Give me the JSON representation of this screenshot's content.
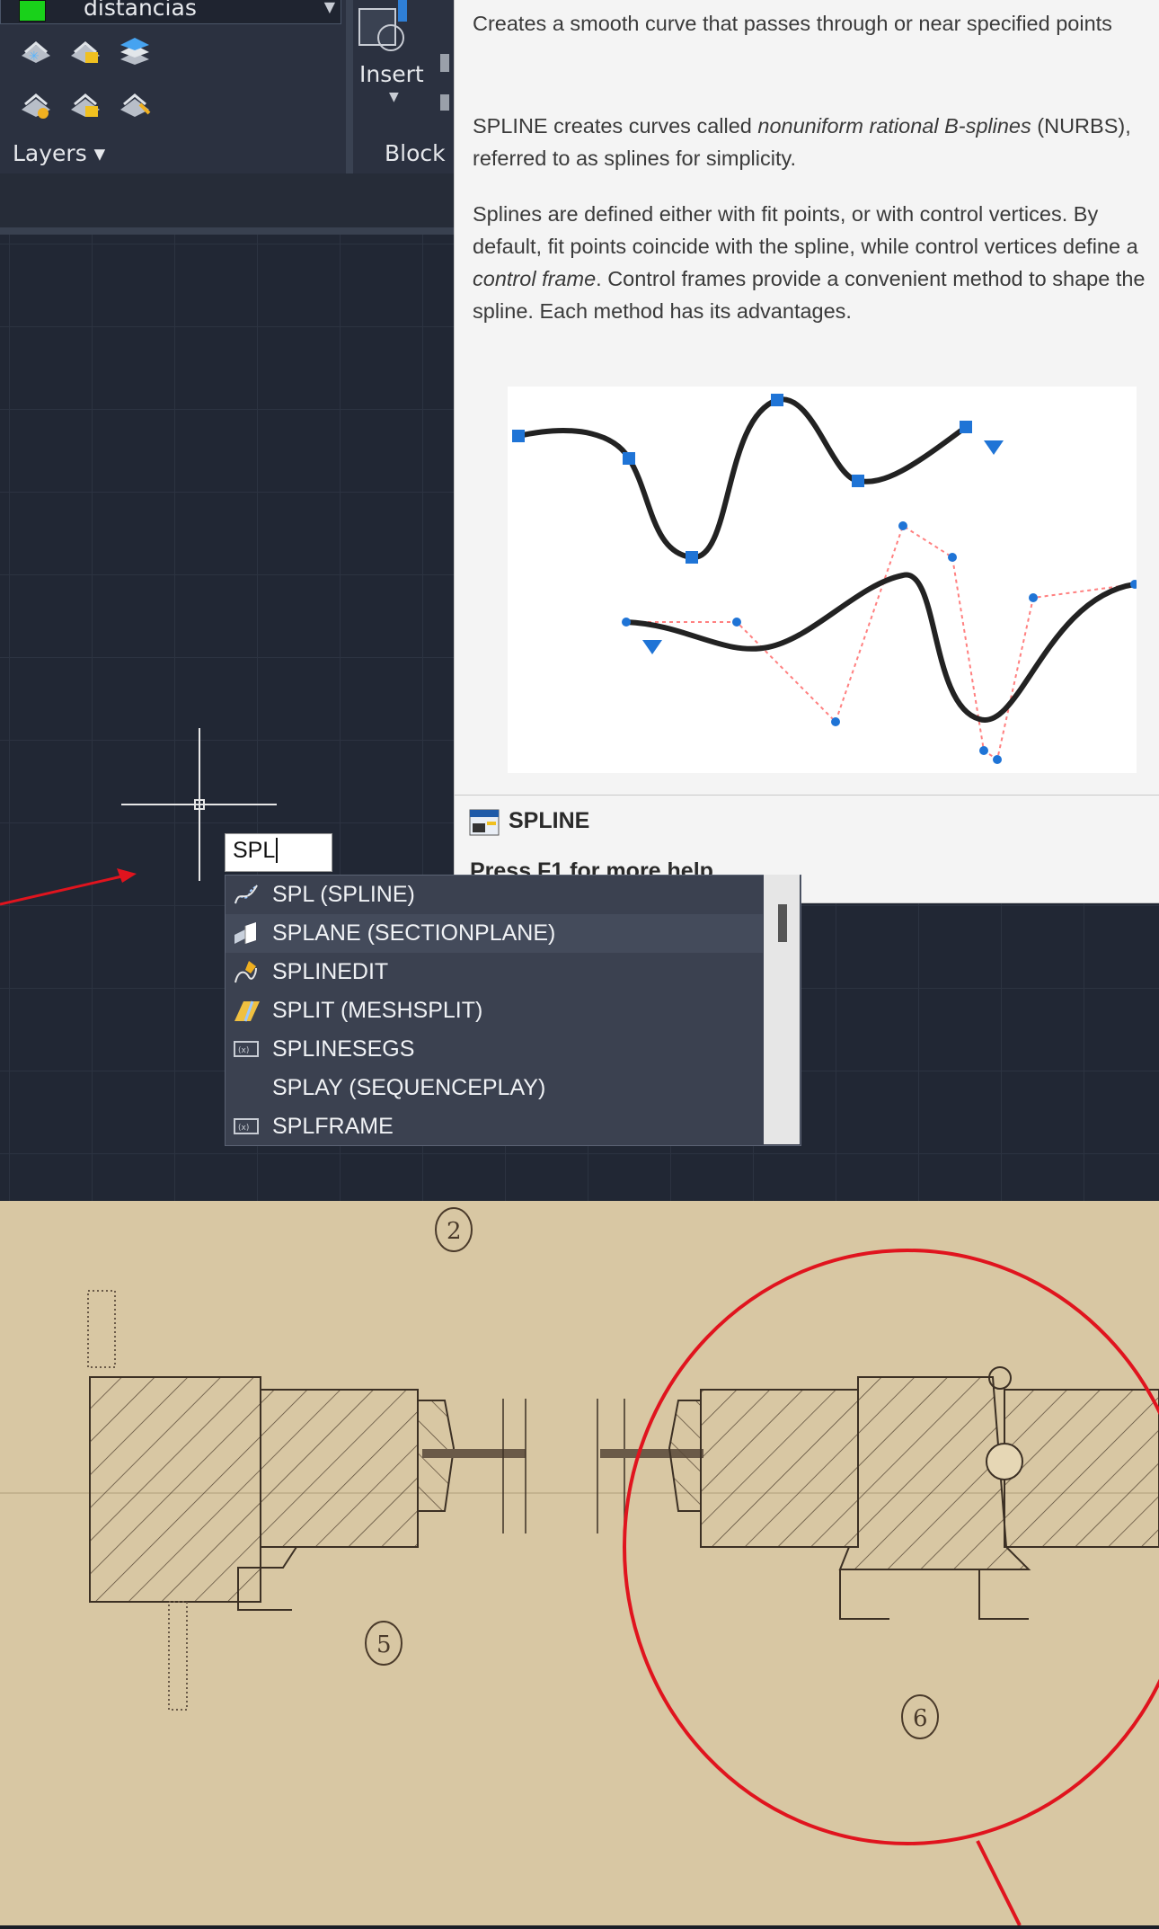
{
  "ribbon": {
    "layer_dropdown_value": "distancias",
    "layer_color": "#19d11a",
    "panel_layers_label": "Layers ▾",
    "insert_label": "Insert",
    "panel_block_label": "Block"
  },
  "tooltip": {
    "para1": "Creates a smooth curve that passes through or near specified points",
    "para2_pre": "SPLINE creates curves called ",
    "para2_em": "nonuniform rational B-splines",
    "para2_post": " (NURBS), referred to as splines for simplicity.",
    "para3_pre": "Splines are defined either with fit points, or with control vertices. By default, fit points coincide with the spline, while control vertices define a ",
    "para3_em": "control frame",
    "para3_post": ". Control frames provide a convenient method to shape the spline. Each method has its advantages.",
    "command_name": "SPLINE",
    "help_text": "Press F1 for more help"
  },
  "command_line": {
    "input_value": "SPL"
  },
  "autocomplete": {
    "items": [
      {
        "label": "SPL (SPLINE)",
        "icon": "spline-icon"
      },
      {
        "label": "SPLANE (SECTIONPLANE)",
        "icon": "section-plane-icon"
      },
      {
        "label": "SPLINEDIT",
        "icon": "spline-edit-icon"
      },
      {
        "label": "SPLIT (MESHSPLIT)",
        "icon": "mesh-split-icon"
      },
      {
        "label": "SPLINESEGS",
        "icon": "system-variable-icon"
      },
      {
        "label": "SPLAY (SEQUENCEPLAY)",
        "icon": ""
      },
      {
        "label": "SPLFRAME",
        "icon": "system-variable-icon"
      }
    ]
  },
  "drawing": {
    "label_2": "2",
    "label_5": "5",
    "label_6": "6"
  },
  "colors": {
    "annotation_red": "#e0141e",
    "canvas": "#212734",
    "paper": "#d8c7a3"
  }
}
